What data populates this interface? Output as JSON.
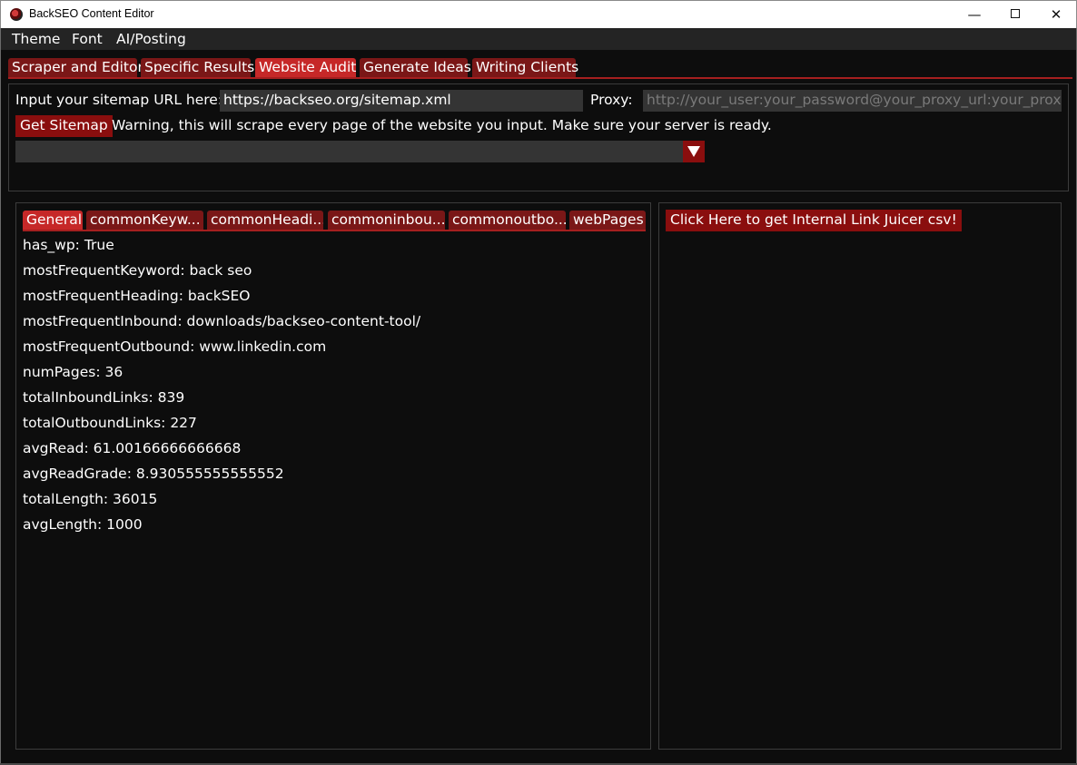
{
  "window": {
    "title": "BackSEO Content Editor",
    "minimize_glyph": "—",
    "close_glyph": "✕"
  },
  "menu": {
    "items": [
      "Theme",
      "Font",
      "AI/Posting"
    ]
  },
  "tabs": [
    {
      "label": "Scraper and Editor",
      "active": false
    },
    {
      "label": "Specific Results",
      "active": false
    },
    {
      "label": "Website Audit",
      "active": true
    },
    {
      "label": "Generate Ideas",
      "active": false
    },
    {
      "label": "Writing Clients",
      "active": false
    }
  ],
  "audit": {
    "sitemap_label": "Input your sitemap URL here:",
    "sitemap_value": "https://backseo.org/sitemap.xml",
    "proxy_label": "Proxy:",
    "proxy_placeholder": "http://your_user:your_password@your_proxy_url:your_proxy_port",
    "get_sitemap_button": "Get Sitemap",
    "warning": "Warning, this will scrape every page of the website you input. Make sure your server is ready.",
    "dropdown_value": ""
  },
  "subtabs": [
    {
      "label": "General",
      "active": true
    },
    {
      "label": "commonKeyw...",
      "active": false
    },
    {
      "label": "commonHeadi...",
      "active": false
    },
    {
      "label": "commoninbou...",
      "active": false
    },
    {
      "label": "commonoutbo...",
      "active": false
    },
    {
      "label": "webPages",
      "active": false
    }
  ],
  "general_stats": [
    "has_wp: True",
    "mostFrequentKeyword: back seo",
    "mostFrequentHeading: backSEO",
    "mostFrequentInbound: downloads/backseo-content-tool/",
    "mostFrequentOutbound: www.linkedin.com",
    "numPages: 36",
    "totalInboundLinks: 839",
    "totalOutboundLinks: 227",
    "avgRead: 61.00166666666668",
    "avgReadGrade: 8.930555555555552",
    "totalLength: 36015",
    "avgLength: 1000"
  ],
  "link_juicer_button": "Click Here to get Internal Link Juicer csv!",
  "colors": {
    "accent_active": "#c62828",
    "accent_tab": "#7a1717",
    "button_red": "#8a0e0e",
    "input_bg": "#343434",
    "background": "#0d0d0d"
  }
}
